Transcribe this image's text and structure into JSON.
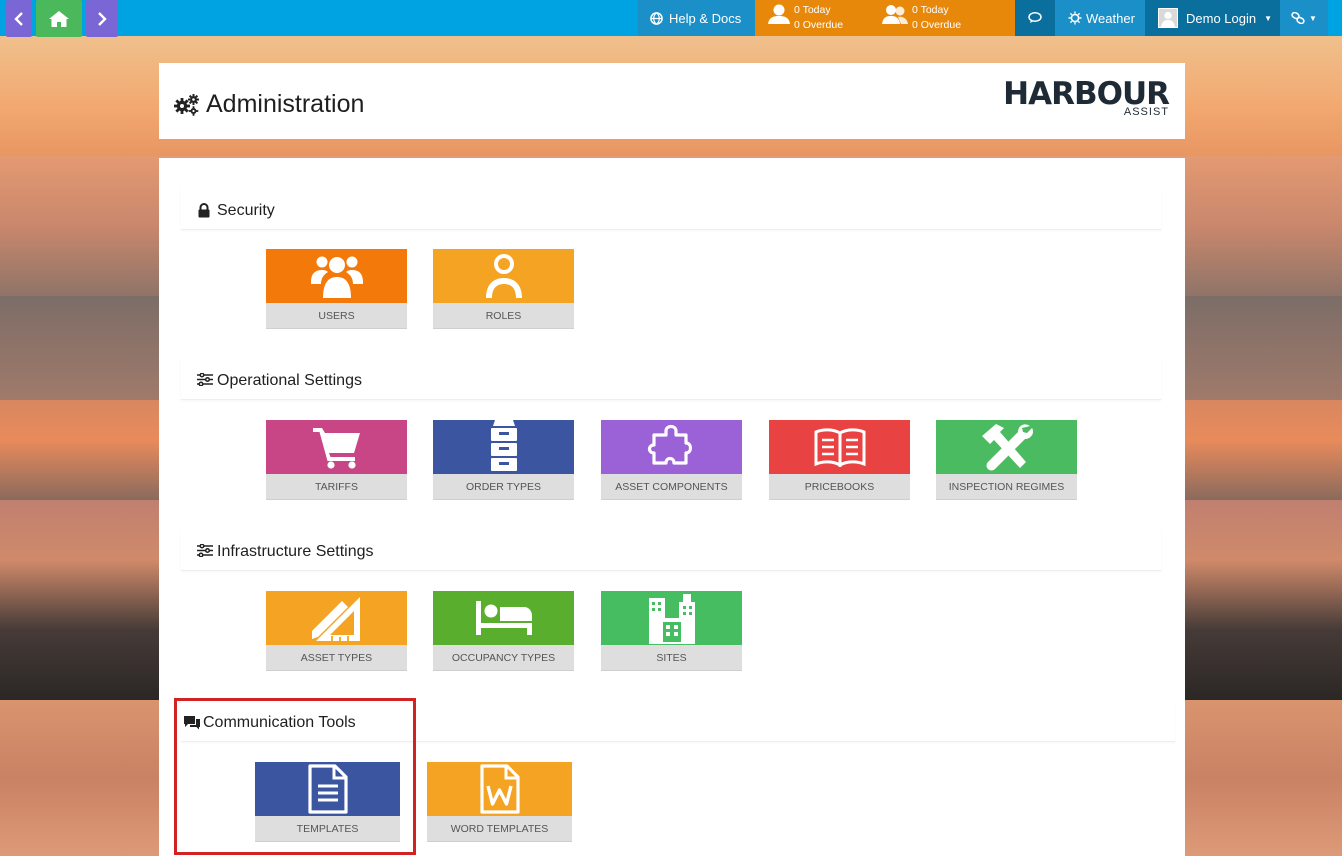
{
  "topbar": {
    "help_label": "Help & Docs",
    "my_tasks": {
      "today": "0 Today",
      "overdue": "0 Overdue"
    },
    "team_tasks": {
      "today": "0 Today",
      "overdue": "0 Overdue"
    },
    "weather_label": "Weather",
    "user_label": "Demo Login",
    "colors": {
      "bar": "#00a3e2",
      "nav_purple": "#7a66d4",
      "nav_green": "#4cb85c",
      "tasks_orange": "#e8880a"
    }
  },
  "header": {
    "title": "Administration",
    "logo_main": "HARBOUR",
    "logo_sub": "ASSIST"
  },
  "sections": [
    {
      "title": "Security",
      "icon": "lock-icon",
      "tiles": [
        {
          "label": "USERS",
          "color": "#f2790a",
          "icon": "users-icon"
        },
        {
          "label": "ROLES",
          "color": "#f5a323",
          "icon": "user-icon"
        }
      ]
    },
    {
      "title": "Operational Settings",
      "icon": "sliders-icon",
      "tiles": [
        {
          "label": "TARIFFS",
          "color": "#c94686",
          "icon": "cart-icon"
        },
        {
          "label": "ORDER TYPES",
          "color": "#3b55a0",
          "icon": "cabinet-icon"
        },
        {
          "label": "ASSET COMPONENTS",
          "color": "#9b62d8",
          "icon": "puzzle-icon"
        },
        {
          "label": "PRICEBOOKS",
          "color": "#e84242",
          "icon": "book-icon"
        },
        {
          "label": "INSPECTION REGIMES",
          "color": "#4abb61",
          "icon": "tools-icon"
        }
      ]
    },
    {
      "title": "Infrastructure Settings",
      "icon": "sliders-icon",
      "tiles": [
        {
          "label": "ASSET TYPES",
          "color": "#f5a323",
          "icon": "ruler-icon"
        },
        {
          "label": "OCCUPANCY TYPES",
          "color": "#5aae2e",
          "icon": "bed-icon"
        },
        {
          "label": "SITES",
          "color": "#47bd62",
          "icon": "buildings-icon"
        }
      ]
    },
    {
      "title": "Communication Tools",
      "icon": "comments-icon",
      "tiles": [
        {
          "label": "TEMPLATES",
          "color": "#3b55a0",
          "icon": "document-icon"
        },
        {
          "label": "WORD TEMPLATES",
          "color": "#f5a323",
          "icon": "word-file-icon"
        }
      ]
    }
  ]
}
